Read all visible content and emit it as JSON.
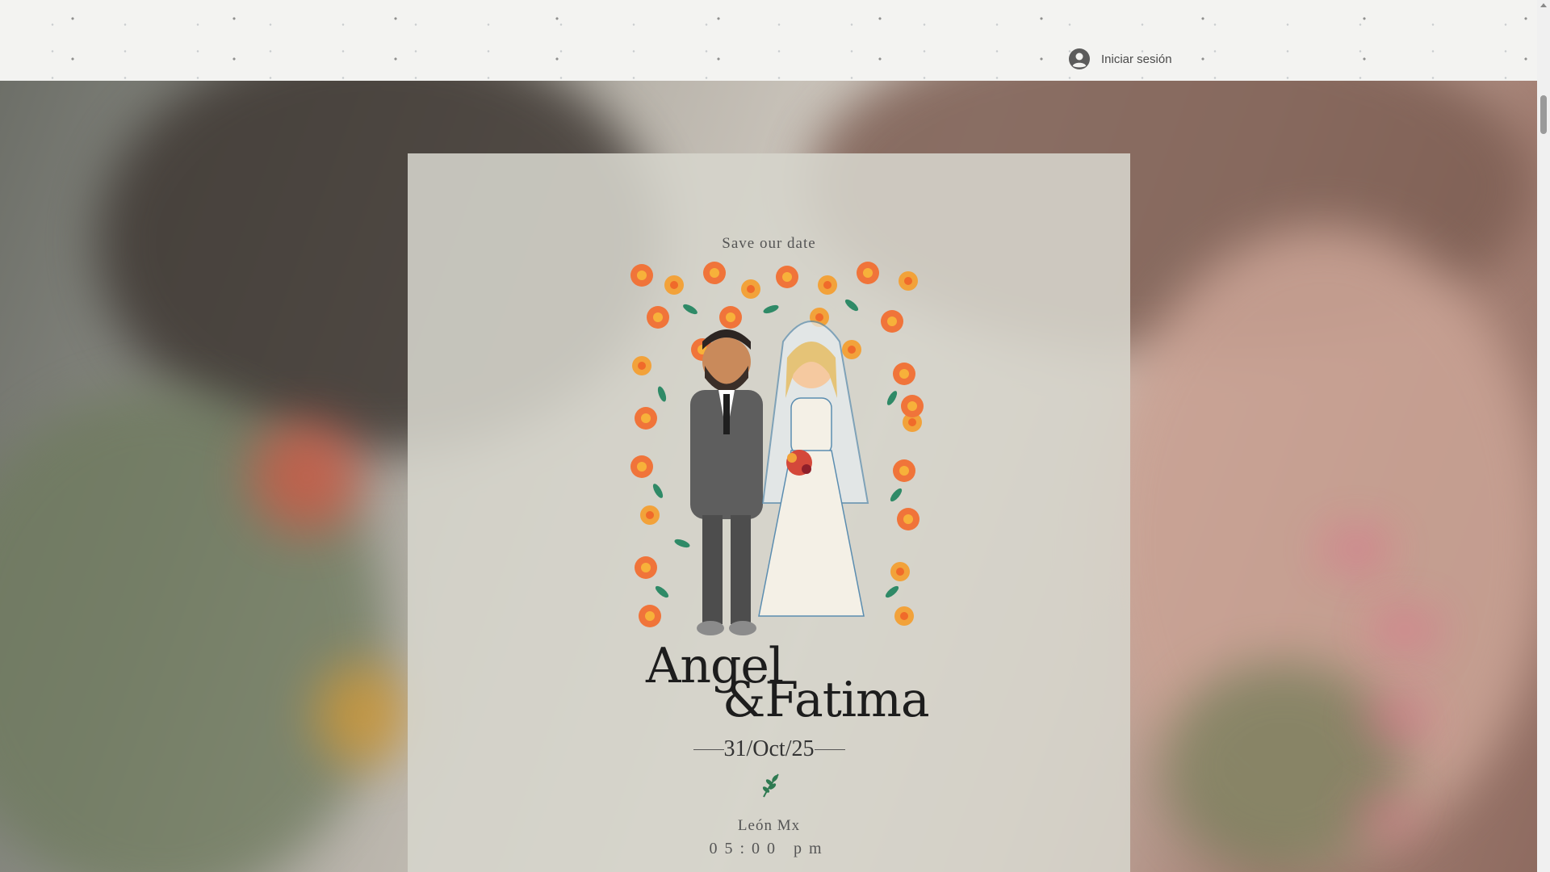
{
  "header": {
    "login_label": "Iniciar sesión",
    "login_icon": "user-avatar-icon"
  },
  "invitation": {
    "tagline": "Save our date",
    "names": {
      "first": "Angel",
      "second": "&Fatima"
    },
    "date": "31/Oct/25",
    "divider_icon": "leaf-sprig-icon",
    "location": "León Mx",
    "time": "05:00 pm",
    "illustration": "bride-and-groom-illustration-with-flowers"
  },
  "colors": {
    "header_bg": "#f3f3f1",
    "card_bg": "#d6d5cc",
    "flower_orange": "#f0743a",
    "flower_yellow": "#f2a23a",
    "leaf_green": "#2f8a67",
    "suit_gray": "#5e5e5e"
  }
}
